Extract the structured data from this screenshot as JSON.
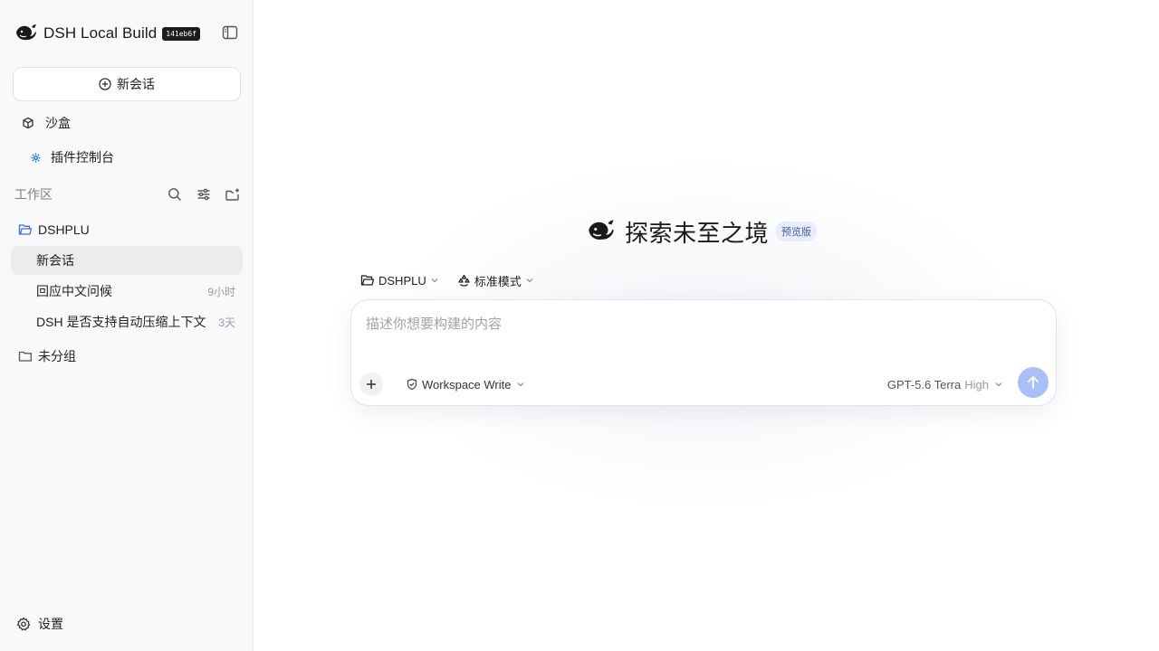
{
  "sidebar": {
    "brand_title": "DSH Local Build",
    "build_hash": "141eb6f",
    "new_chat_label": "新会话",
    "sandbox_label": "沙盒",
    "plugin_console_label": "插件控制台",
    "workspace_label": "工作区",
    "folders": [
      {
        "name": "DSHPLU",
        "conversations": [
          {
            "title": "新会话",
            "time": "",
            "active": true
          },
          {
            "title": "回应中文问候",
            "time": "9小时",
            "active": false
          },
          {
            "title": "DSH 是否支持自动压缩上下文",
            "time": "3天",
            "active": false
          }
        ]
      },
      {
        "name": "未分组",
        "conversations": []
      }
    ],
    "settings_label": "设置",
    "icons": {
      "logo": "whale-logo-icon",
      "collapse": "sidebar-toggle-icon",
      "new_chat": "plus-circle-icon",
      "sandbox": "cube-icon",
      "plugins": "gear-icon",
      "search": "search-icon",
      "filter": "sliders-icon",
      "new_folder": "new-folder-icon",
      "folder": "folder-icon",
      "settings": "settings-icon"
    }
  },
  "main": {
    "hero_title": "探索未至之境",
    "preview_badge": "预览版",
    "project_selector": "DSHPLU",
    "mode_selector": "标准模式",
    "composer": {
      "placeholder": "描述你想要构建的内容",
      "value": "",
      "permission": "Workspace Write",
      "model": "GPT-5.6 Terra",
      "effort": "High"
    }
  },
  "colors": {
    "accent": "#a9c0f6",
    "badge_bg": "#e7edfa",
    "badge_text": "#3e5da8",
    "active_row": "#ececef",
    "plugin_icon": "#2f80c8"
  }
}
